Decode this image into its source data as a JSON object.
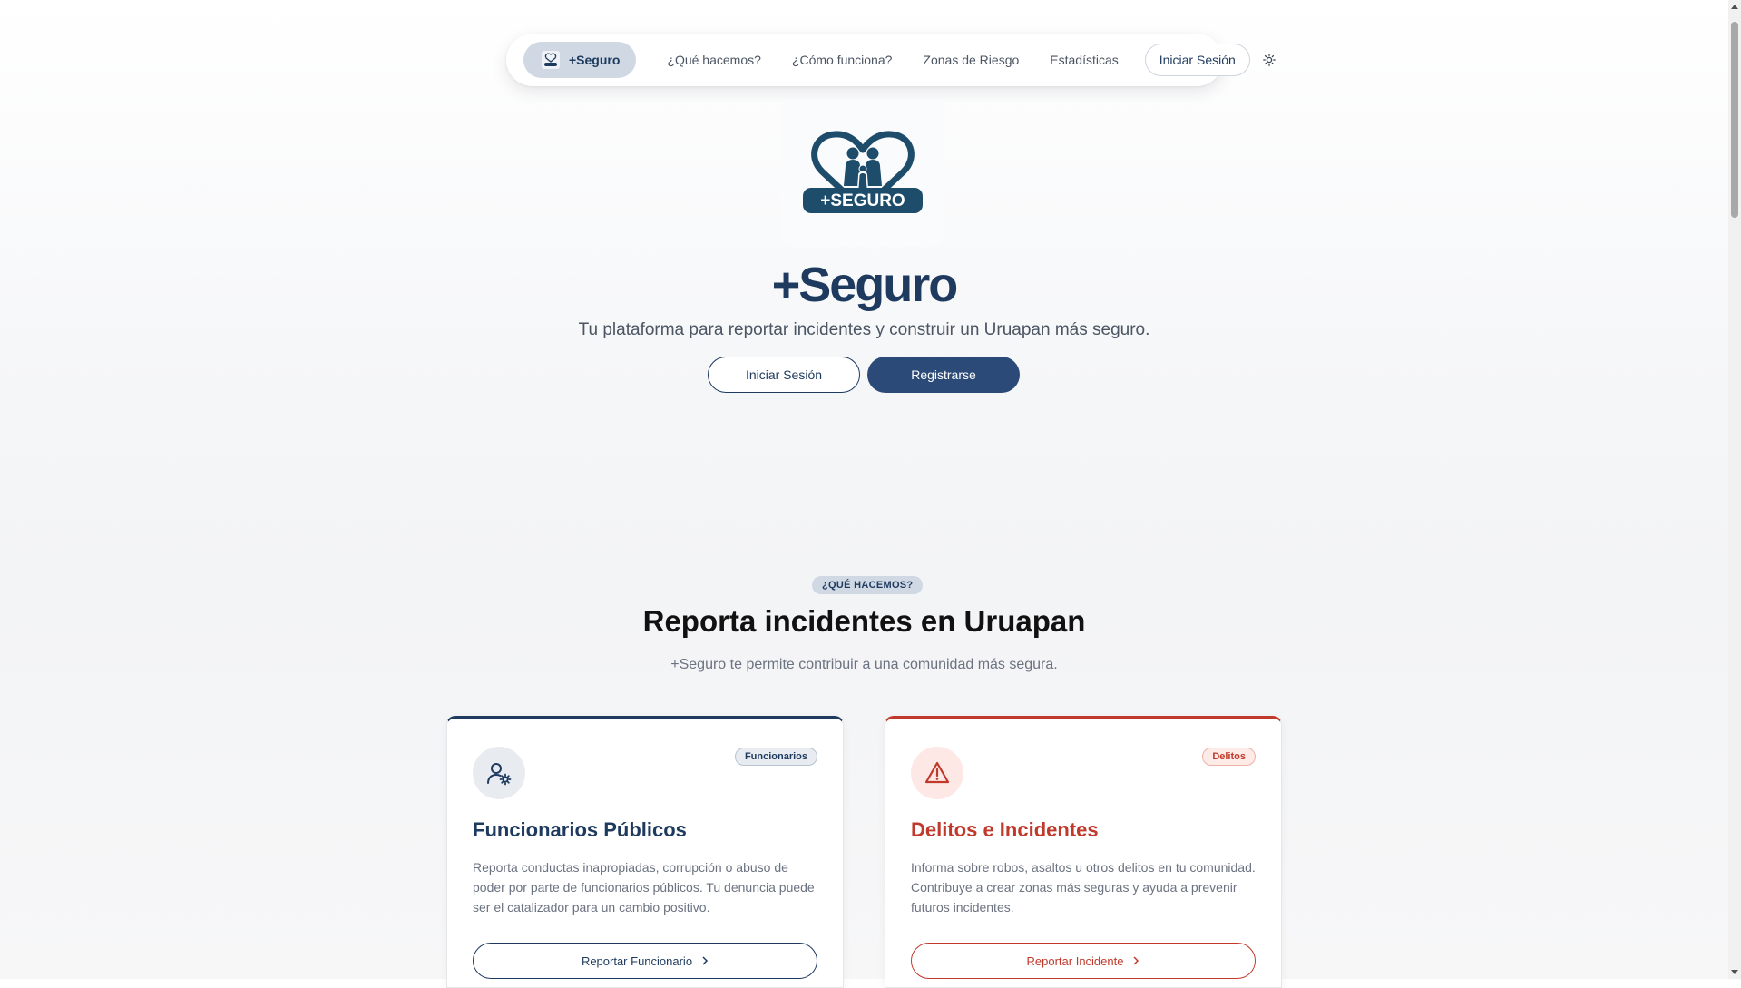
{
  "nav": {
    "brand": "+Seguro",
    "links": [
      "¿Qué hacemos?",
      "¿Cómo funciona?",
      "Zonas de Riesgo",
      "Estadísticas"
    ],
    "login": "Iniciar Sesión",
    "theme_icon": "sun-icon"
  },
  "hero": {
    "logo_text": "+SEGURO",
    "title": "+Seguro",
    "subtitle": "Tu plataforma para reportar incidentes y construir un Uruapan más seguro.",
    "login_button": "Iniciar Sesión",
    "register_button": "Registrarse"
  },
  "section": {
    "pill": "¿QUÉ HACEMOS?",
    "title": "Reporta incidentes en Uruapan",
    "subtitle": "+Seguro te permite contribuir a una comunidad más segura."
  },
  "cards": [
    {
      "badge": "Funcionarios",
      "title": "Funcionarios Públicos",
      "description": "Reporta conductas inapropiadas, corrupción o abuso de poder por parte de funcionarios públicos. Tu denuncia puede ser el catalizador para un cambio positivo.",
      "button": "Reportar Funcionario",
      "icon": "user-gear-icon",
      "accent": "#1e3a5f"
    },
    {
      "badge": "Delitos",
      "title": "Delitos e Incidentes",
      "description": "Informa sobre robos, asaltos u otros delitos en tu comunidad. Contribuye a crear zonas más seguras y ayuda a prevenir futuros incidentes.",
      "button": "Reportar Incidente",
      "icon": "warning-triangle-icon",
      "accent": "#c0392b"
    }
  ],
  "colors": {
    "primary": "#1e3a5f",
    "primary_button": "#2b4a77",
    "danger": "#c0392b"
  }
}
